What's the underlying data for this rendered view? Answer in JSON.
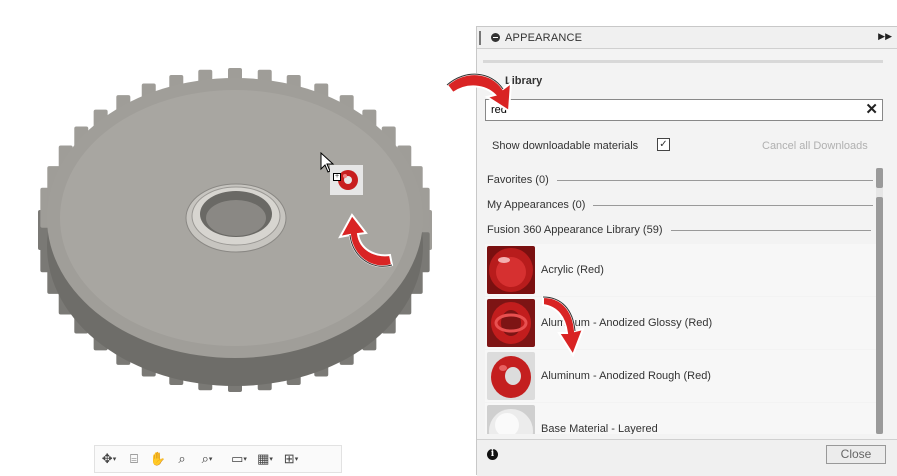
{
  "panel": {
    "title": "APPEARANCE",
    "library_label": "Library",
    "search_value": "red",
    "show_downloadable_label": "Show downloadable materials",
    "show_downloadable_checked": true,
    "cancel_downloads_label": "Cancel all Downloads",
    "sections": {
      "favorites": "Favorites (0)",
      "my_appearances": "My Appearances (0)",
      "library": "Fusion 360 Appearance Library (59)"
    },
    "items": [
      {
        "label": "Acrylic (Red)",
        "icon": "red-glass-sphere"
      },
      {
        "label": "Aluminum - Anodized Glossy (Red)",
        "icon": "red-metal-ring"
      },
      {
        "label": "Aluminum - Anodized Rough (Red)",
        "icon": "red-metal-torus"
      },
      {
        "label": "Base Material - Layered",
        "icon": "white-sphere"
      }
    ],
    "close_label": "Close"
  },
  "viewport": {
    "model": "spur-gear",
    "toolbar_icons": [
      "orbit-icon",
      "look-at-icon",
      "pan-icon",
      "zoom-icon",
      "fit-icon",
      "display-settings-icon",
      "grid-icon",
      "viewports-icon"
    ]
  },
  "colors": {
    "accent_red": "#cc1f1f",
    "gear_gray": "#9a9893",
    "panel_bg": "#f3f3f3"
  }
}
